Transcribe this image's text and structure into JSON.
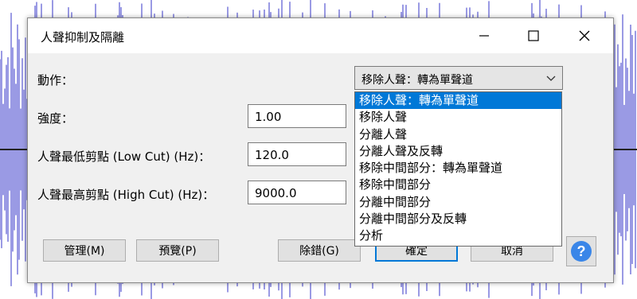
{
  "dialog": {
    "title": "人聲抑制及隔離",
    "fields": {
      "action_label": "動作：",
      "strength_label": "強度：",
      "strength_value": "1.00",
      "low_cut_label": "人聲最低剪點 (Low Cut) (Hz)：",
      "low_cut_value": "120.0",
      "high_cut_label": "人聲最高剪點 (High Cut) (Hz)：",
      "high_cut_value": "9000.0"
    },
    "action_select": {
      "selected": "移除人聲：轉為單聲道",
      "options": [
        "移除人聲：轉為單聲道",
        "移除人聲",
        "分離人聲",
        "分離人聲及反轉",
        "移除中間部分：轉為單聲道",
        "移除中間部分",
        "分離中間部分",
        "分離中間部分及反轉",
        "分析"
      ]
    },
    "buttons": {
      "manage": "管理(M)",
      "preview": "預覽(P)",
      "debug": "除錯(G)",
      "ok": "確定",
      "cancel": "取消",
      "help": "?"
    }
  },
  "colors": {
    "accent": "#0078d7",
    "wave": "#3535c8",
    "help": "#3a86e8"
  }
}
